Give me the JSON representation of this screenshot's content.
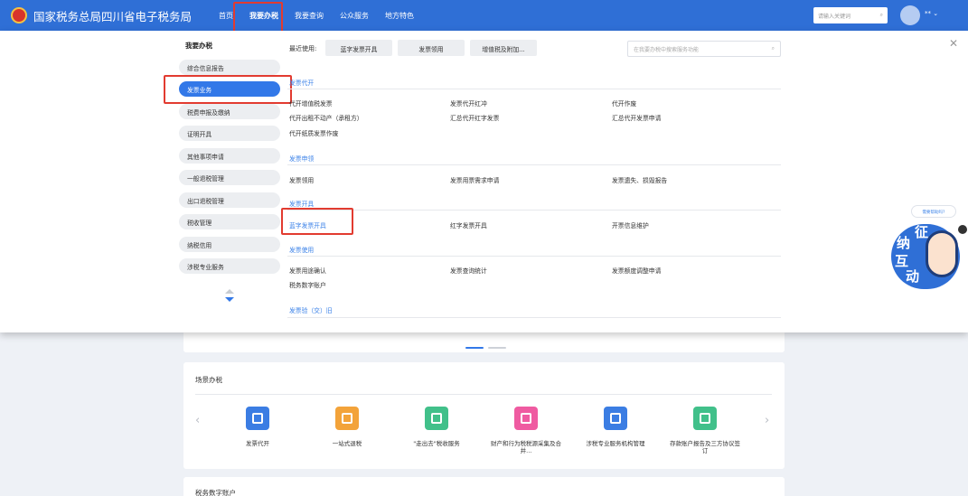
{
  "header": {
    "site_title": "国家税务总局四川省电子税务局",
    "nav": [
      "首页",
      "我要办税",
      "我要查询",
      "公众服务",
      "地方特色"
    ],
    "search_placeholder": "请输入关键词",
    "user_name": "**",
    "brand_color": "#2f6fd6"
  },
  "sidebar": {
    "title": "我要办税",
    "items": [
      "综合信息报告",
      "发票业务",
      "税费申报及缴纳",
      "证明开具",
      "其他事项申请",
      "一般退税管理",
      "出口退税管理",
      "税收管理",
      "纳税信用",
      "涉税专业服务"
    ]
  },
  "recent": {
    "label": "最近使用:",
    "buttons": [
      "蓝字发票开具",
      "发票领用",
      "增值税及附加..."
    ],
    "search_placeholder": "在我要办税中搜索服务功能"
  },
  "sections": [
    {
      "title": "发票代开",
      "links": [
        "代开增值税发票",
        "发票代开红冲",
        "代开作废",
        "代开出租不动产（承租方）",
        "汇总代开红字发票",
        "汇总代开发票申请",
        "代开纸质发票作废"
      ]
    },
    {
      "title": "发票申领",
      "links": [
        "发票领用",
        "发票用票需求申请",
        "发票遗失、损毁报告"
      ]
    },
    {
      "title": "发票开具",
      "links": [
        "蓝字发票开具",
        "红字发票开具",
        "开票信息维护"
      ]
    },
    {
      "title": "发票使用",
      "links": [
        "发票用途确认",
        "发票查询统计",
        "发票额度调整申请",
        "税务数字账户"
      ]
    },
    {
      "title": "发票验（交）旧",
      "links": []
    }
  ],
  "scene": {
    "title": "场景办税",
    "tiles": [
      "发票代开",
      "一站式退税",
      "\"走出去\"税收服务",
      "财产和行为税税源采集及合并...",
      "涉税专业服务机构管理",
      "存款账户报告及三方协议签订"
    ],
    "tile_colors": [
      "#3b7de3",
      "#f3a33a",
      "#41c08a",
      "#ef5ba1",
      "#3b7de3",
      "#41c08a"
    ]
  },
  "account": {
    "title": "税务数字账户"
  },
  "widget": {
    "bubble": "需要帮助吗?",
    "chars": [
      "征",
      "纳",
      "互",
      "动"
    ]
  }
}
